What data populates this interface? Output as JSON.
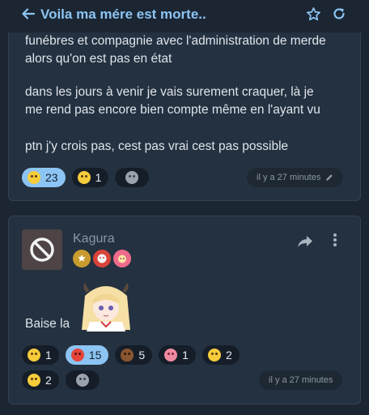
{
  "header": {
    "title": "Voila ma mére est morte..",
    "back_icon": "arrow-left-icon",
    "bookmark_icon": "star-outline-icon",
    "refresh_icon": "refresh-icon",
    "accent": "#8cc4f3"
  },
  "post1": {
    "paragraphs": [
      "funébres et compagnie avec l'administration de merde\nalors qu'on est pas en état",
      "dans les jours à venir je vais surement craquer, là je\nme rend pas encore bien compte même en l'ayant vu",
      "ptn j'y crois pas, cest pas vrai cest pas possible"
    ],
    "reactions": [
      {
        "emoji": "sad-face",
        "count": "23",
        "active": true
      },
      {
        "emoji": "crying-laughing-face",
        "count": "1",
        "active": false
      },
      {
        "emoji": "add-reaction",
        "count": "",
        "active": false
      }
    ],
    "timestamp": "il y a 27 minutes",
    "edited_icon": "pencil-icon"
  },
  "post2": {
    "username": "Kagura",
    "avatar_icon": "blocked-avatar-icon",
    "badges": [
      "gold-star-badge",
      "red-mascot-badge",
      "pink-face-badge"
    ],
    "share_icon": "share-arrow-icon",
    "more_icon": "more-vertical-icon",
    "text": "Baise la",
    "sticker": "anime-girl-sticker",
    "reactions_row1": [
      {
        "emoji": "crying-laughing-face",
        "count": "1",
        "active": false
      },
      {
        "emoji": "angry-face",
        "count": "15",
        "active": true
      },
      {
        "emoji": "poop",
        "count": "5",
        "active": false
      },
      {
        "emoji": "pink-blob",
        "count": "1",
        "active": false
      },
      {
        "emoji": "smirk-face",
        "count": "2",
        "active": false
      }
    ],
    "reactions_row2": [
      {
        "emoji": "thinking-face",
        "count": "2",
        "active": false
      },
      {
        "emoji": "add-reaction",
        "count": "",
        "active": false
      }
    ],
    "timestamp": "il y a 27 minutes"
  }
}
